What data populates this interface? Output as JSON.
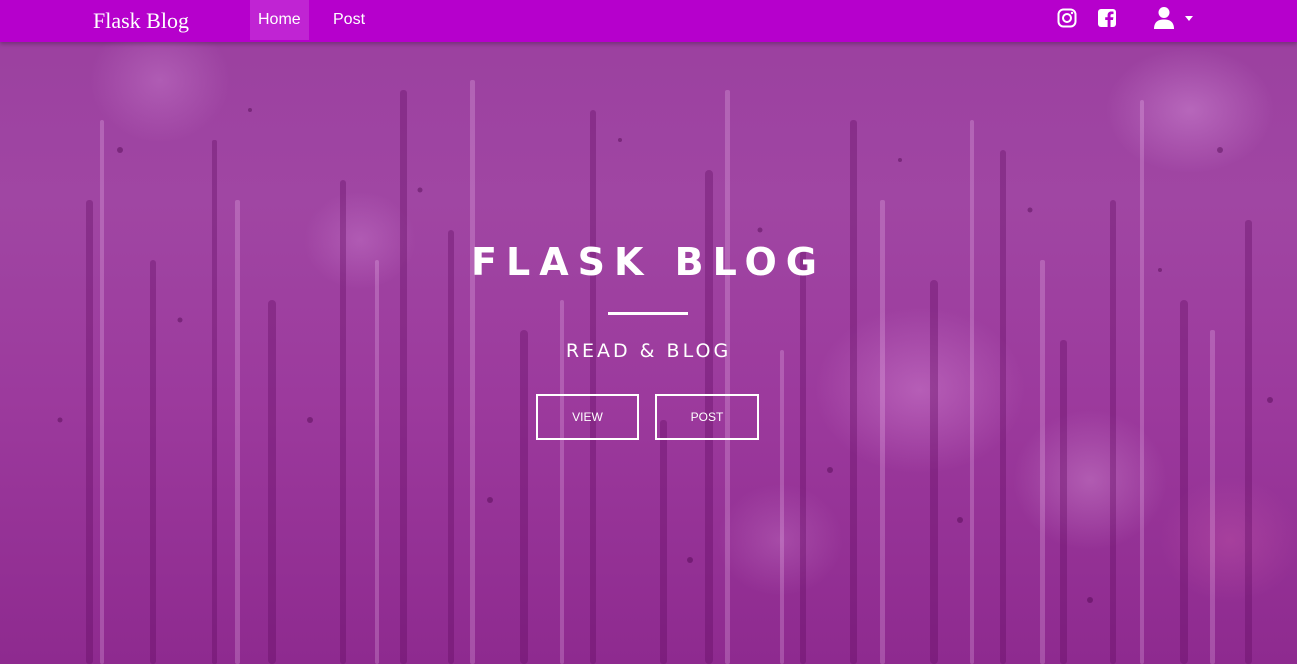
{
  "navbar": {
    "brand": "Flask Blog",
    "links": [
      {
        "label": "Home",
        "active": true
      },
      {
        "label": "Post",
        "active": false
      }
    ],
    "icons": [
      "instagram-icon",
      "facebook-icon",
      "user-icon",
      "caret-down-icon"
    ],
    "background_color": "#b600cc"
  },
  "hero": {
    "title": "FLASK BLOG",
    "subtitle": "READ & BLOG",
    "buttons": [
      {
        "label": "VIEW"
      },
      {
        "label": "POST"
      }
    ],
    "background_color": "#9c3a9d"
  }
}
